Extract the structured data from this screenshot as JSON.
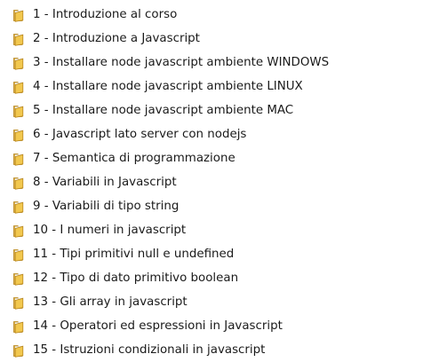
{
  "folders": [
    {
      "label": "1 - Introduzione al corso",
      "icon": "folder-icon"
    },
    {
      "label": "2 - Introduzione a Javascript",
      "icon": "folder-icon"
    },
    {
      "label": "3 - Installare node javascript ambiente WINDOWS",
      "icon": "folder-icon"
    },
    {
      "label": "4 - Installare node javascript ambiente LINUX",
      "icon": "folder-icon"
    },
    {
      "label": "5 - Installare node javascript ambiente MAC",
      "icon": "folder-icon"
    },
    {
      "label": "6 - Javascript lato server con nodejs",
      "icon": "folder-icon"
    },
    {
      "label": "7 - Semantica di programmazione",
      "icon": "folder-icon"
    },
    {
      "label": "8 - Variabili in Javascript",
      "icon": "folder-icon"
    },
    {
      "label": "9 - Variabili di tipo string",
      "icon": "folder-icon"
    },
    {
      "label": "10 - I numeri in javascript",
      "icon": "folder-icon"
    },
    {
      "label": "11 - Tipi primitivi null e undefined",
      "icon": "folder-icon"
    },
    {
      "label": "12 - Tipo di dato primitivo boolean",
      "icon": "folder-icon"
    },
    {
      "label": "13 - Gli array in javascript",
      "icon": "folder-icon"
    },
    {
      "label": "14 - Operatori ed espressioni in Javascript",
      "icon": "folder-icon"
    },
    {
      "label": "15 - Istruzioni condizionali in javascript",
      "icon": "folder-icon"
    }
  ],
  "colors": {
    "folder_body": "#f2c84f",
    "folder_back": "#d9a52c",
    "folder_edge": "#b8861c",
    "folder_paper": "#ffffff",
    "text": "#1a1a1a"
  }
}
